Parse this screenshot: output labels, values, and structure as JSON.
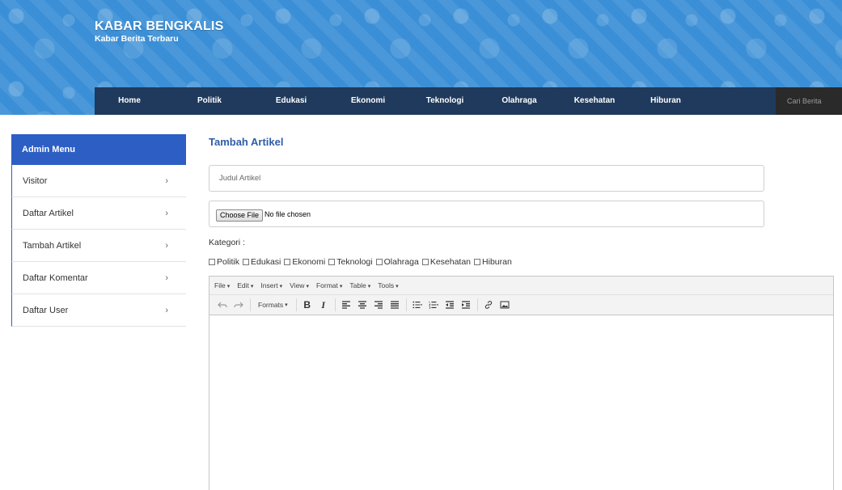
{
  "brand": {
    "title": "KABAR BENGKALIS",
    "subtitle": "Kabar Berita Terbaru"
  },
  "nav": {
    "items": [
      "Home",
      "Politik",
      "Edukasi",
      "Ekonomi",
      "Teknologi",
      "Olahraga",
      "Kesehatan",
      "Hiburan"
    ],
    "search_placeholder": "Cari Berita"
  },
  "sidebar": {
    "header": "Admin Menu",
    "items": [
      {
        "label": "Visitor"
      },
      {
        "label": "Daftar Artikel"
      },
      {
        "label": "Tambah Artikel"
      },
      {
        "label": "Daftar Komentar"
      },
      {
        "label": "Daftar User"
      }
    ],
    "chevron": "›"
  },
  "main": {
    "title": "Tambah Artikel",
    "title_placeholder": "Judul Artikel",
    "file_button": "Choose File",
    "file_status": "No file chosen",
    "kategori_label": "Kategori :",
    "kategori": [
      "Politik",
      "Edukasi",
      "Ekonomi",
      "Teknologi",
      "Olahraga",
      "Kesehatan",
      "Hiburan"
    ]
  },
  "editor": {
    "menus": [
      "File",
      "Edit",
      "Insert",
      "View",
      "Format",
      "Table",
      "Tools"
    ],
    "formats_label": "Formats",
    "bold": "B",
    "italic": "I"
  },
  "colors": {
    "header_blue": "#3b8fd6",
    "navbar": "#1f3a5c",
    "sidebar_header": "#2d5ec4",
    "title_blue": "#2d5ea8"
  }
}
